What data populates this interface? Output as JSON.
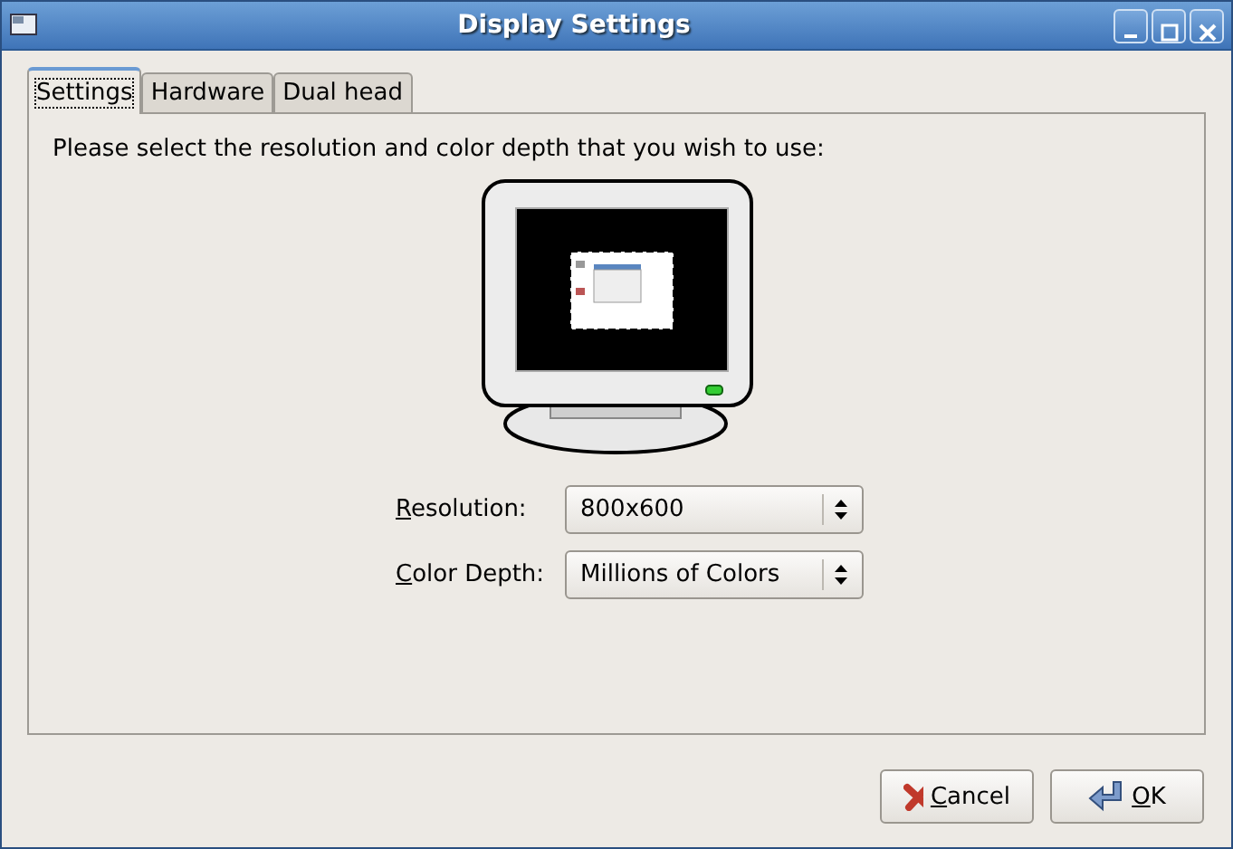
{
  "window": {
    "title": "Display Settings"
  },
  "tabs": [
    {
      "label": "Settings",
      "selected": true
    },
    {
      "label": "Hardware",
      "selected": false
    },
    {
      "label": "Dual head",
      "selected": false
    }
  ],
  "prompt": "Please select the resolution and color depth that you wish to use:",
  "fields": [
    {
      "label": "Resolution:",
      "value": "800x600"
    },
    {
      "label": "Color Depth:",
      "value": "Millions of Colors"
    }
  ],
  "buttons": [
    {
      "kind": "cancel",
      "label": "Cancel"
    },
    {
      "kind": "ok",
      "label": "OK"
    }
  ]
}
